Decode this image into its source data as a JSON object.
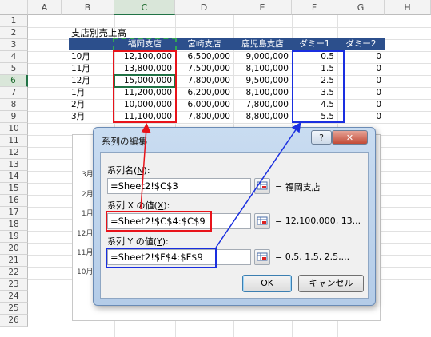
{
  "columns": [
    "A",
    "B",
    "C",
    "D",
    "E",
    "F",
    "G",
    "H"
  ],
  "rows": [
    "1",
    "2",
    "3",
    "4",
    "5",
    "6",
    "7",
    "8",
    "9",
    "10",
    "11",
    "12",
    "13",
    "14",
    "15",
    "16",
    "17",
    "18",
    "19",
    "20",
    "21",
    "22",
    "23",
    "24",
    "25",
    "26"
  ],
  "sheet": {
    "title": "支店別売上高",
    "headers": [
      "福岡支店",
      "宮崎支店",
      "鹿児島支店",
      "ダミー1",
      "ダミー2"
    ],
    "data_rows": [
      {
        "month": "10月",
        "fukuoka": "12,100,000",
        "miyazaki": "6,500,000",
        "kagoshima": "9,000,000",
        "dummy1": "0.5",
        "dummy2": "0"
      },
      {
        "month": "11月",
        "fukuoka": "13,800,000",
        "miyazaki": "7,500,000",
        "kagoshima": "8,100,000",
        "dummy1": "1.5",
        "dummy2": "0"
      },
      {
        "month": "12月",
        "fukuoka": "15,000,000",
        "miyazaki": "7,800,000",
        "kagoshima": "9,500,000",
        "dummy1": "2.5",
        "dummy2": "0"
      },
      {
        "month": "1月",
        "fukuoka": "11,200,000",
        "miyazaki": "6,200,000",
        "kagoshima": "8,100,000",
        "dummy1": "3.5",
        "dummy2": "0"
      },
      {
        "month": "2月",
        "fukuoka": "10,000,000",
        "miyazaki": "6,000,000",
        "kagoshima": "7,800,000",
        "dummy1": "4.5",
        "dummy2": "0"
      },
      {
        "month": "3月",
        "fukuoka": "11,100,000",
        "miyazaki": "7,800,000",
        "kagoshima": "8,800,000",
        "dummy1": "5.5",
        "dummy2": "0"
      }
    ]
  },
  "chart_bg": {
    "axis_labels": [
      "3月",
      "2月",
      "1月",
      "12月",
      "11月",
      "10月"
    ]
  },
  "dialog": {
    "title": "系列の編集",
    "help_label": "?",
    "close_label": "✕",
    "series_name_label": "系列名(",
    "series_name_key": "N",
    "series_name_ref": "=Sheet2!$C$3",
    "series_name_value": "= 福岡支店",
    "x_label": "系列 X の値(",
    "x_key": "X",
    "x_ref": "=Sheet2!$C$4:$C$9",
    "x_value": "= 12,100,000, 13...",
    "y_label": "系列 Y の値(",
    "y_key": "Y",
    "y_ref": "=Sheet2!$F$4:$F$9",
    "y_value": "= 0.5, 1.5, 2.5,...",
    "label_close": "):",
    "ok_label": "OK",
    "cancel_label": "キャンセル"
  },
  "colors": {
    "header_fill": "#2c4f8c",
    "red_highlight": "#e8131a",
    "blue_highlight": "#1a2fe0",
    "excel_green": "#217346"
  }
}
